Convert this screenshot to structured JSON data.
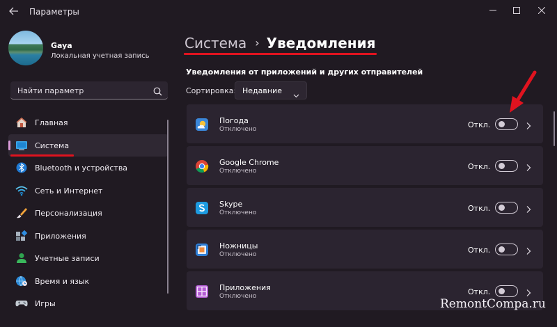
{
  "window": {
    "title": "Параметры"
  },
  "profile": {
    "name": "Gaya",
    "subtitle": "Локальная учетная запись"
  },
  "search": {
    "placeholder": "Найти параметр"
  },
  "nav": {
    "items": [
      {
        "label": "Главная",
        "icon": "home-icon"
      },
      {
        "label": "Система",
        "icon": "system-icon",
        "active": true
      },
      {
        "label": "Bluetooth и устройства",
        "icon": "bluetooth-icon"
      },
      {
        "label": "Сеть и Интернет",
        "icon": "wifi-icon"
      },
      {
        "label": "Персонализация",
        "icon": "brush-icon"
      },
      {
        "label": "Приложения",
        "icon": "apps-icon"
      },
      {
        "label": "Учетные записи",
        "icon": "accounts-icon"
      },
      {
        "label": "Время и язык",
        "icon": "globe-clock-icon"
      },
      {
        "label": "Игры",
        "icon": "gamepad-icon"
      }
    ]
  },
  "breadcrumb": {
    "parent": "Система",
    "separator": "›",
    "current": "Уведомления"
  },
  "section": {
    "title": "Уведомления от приложений и других отправителей"
  },
  "sort": {
    "label": "Сортировка:",
    "value": "Недавние"
  },
  "apps": [
    {
      "name": "Погода",
      "status": "Отключено",
      "toggle_label": "Откл.",
      "icon": "weather-icon",
      "enabled": false
    },
    {
      "name": "Google Chrome",
      "status": "Отключено",
      "toggle_label": "Откл.",
      "icon": "chrome-icon",
      "enabled": false
    },
    {
      "name": "Skype",
      "status": "Отключено",
      "toggle_label": "Откл.",
      "icon": "skype-icon",
      "enabled": false
    },
    {
      "name": "Ножницы",
      "status": "Отключено",
      "toggle_label": "Откл.",
      "icon": "snipping-tool-icon",
      "enabled": false
    },
    {
      "name": "Приложения",
      "status": "Отключено",
      "toggle_label": "Откл.",
      "icon": "apps-tile-icon",
      "enabled": false
    }
  ],
  "watermark": "RemontCompa.ru",
  "colors": {
    "background": "#201a22",
    "card": "#2b2430",
    "accent_underline": "#e0131f",
    "nav_indicator": "#d99ad8"
  }
}
